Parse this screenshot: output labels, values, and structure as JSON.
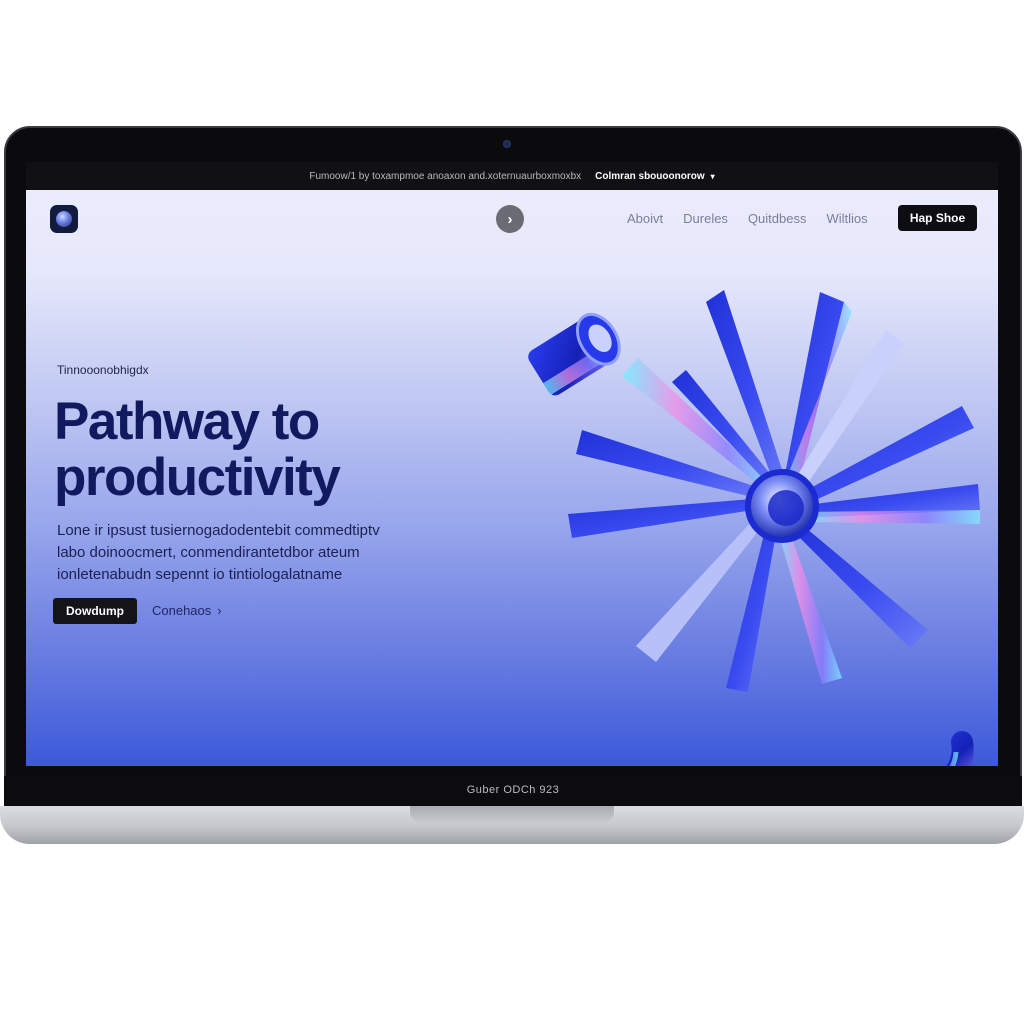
{
  "topbar": {
    "message": "Fumoow/1 by toxampmoe anoaxon and.xoternuaurboxmoxbx",
    "link_label": "Colmran sbouoonorow"
  },
  "nav": {
    "links": [
      {
        "label": "Aboivt"
      },
      {
        "label": "Dureles"
      },
      {
        "label": "Quitdbess"
      },
      {
        "label": "Wiltlios"
      }
    ],
    "cta_label": "Hap Shoe"
  },
  "hero": {
    "eyebrow": "Tinnooonobhigdx",
    "headline_line1": "Pathway to",
    "headline_line2": "productivity",
    "body_line1": "Lone ir ipsust tusiernogadodentebit commedtiptv",
    "body_line2": "labo doinoocmert, conmendirantetdbor ateum",
    "body_line3": "ionletenabudn sepennt io tintiologalatname",
    "primary_button": "Dowdump",
    "secondary_link": "Conehaos"
  },
  "device": {
    "chin_label": "Guber ODCh 923"
  },
  "icons": {
    "logo": "sphere-logo-icon",
    "nav_arrow": "chevron-right-icon",
    "topbar_caret": "caret-down-icon",
    "secondary_link_arrow": "chevron-right-icon"
  },
  "colors": {
    "accent": "#2b3fe0",
    "headline": "#111a5e",
    "button_dark": "#141418"
  }
}
